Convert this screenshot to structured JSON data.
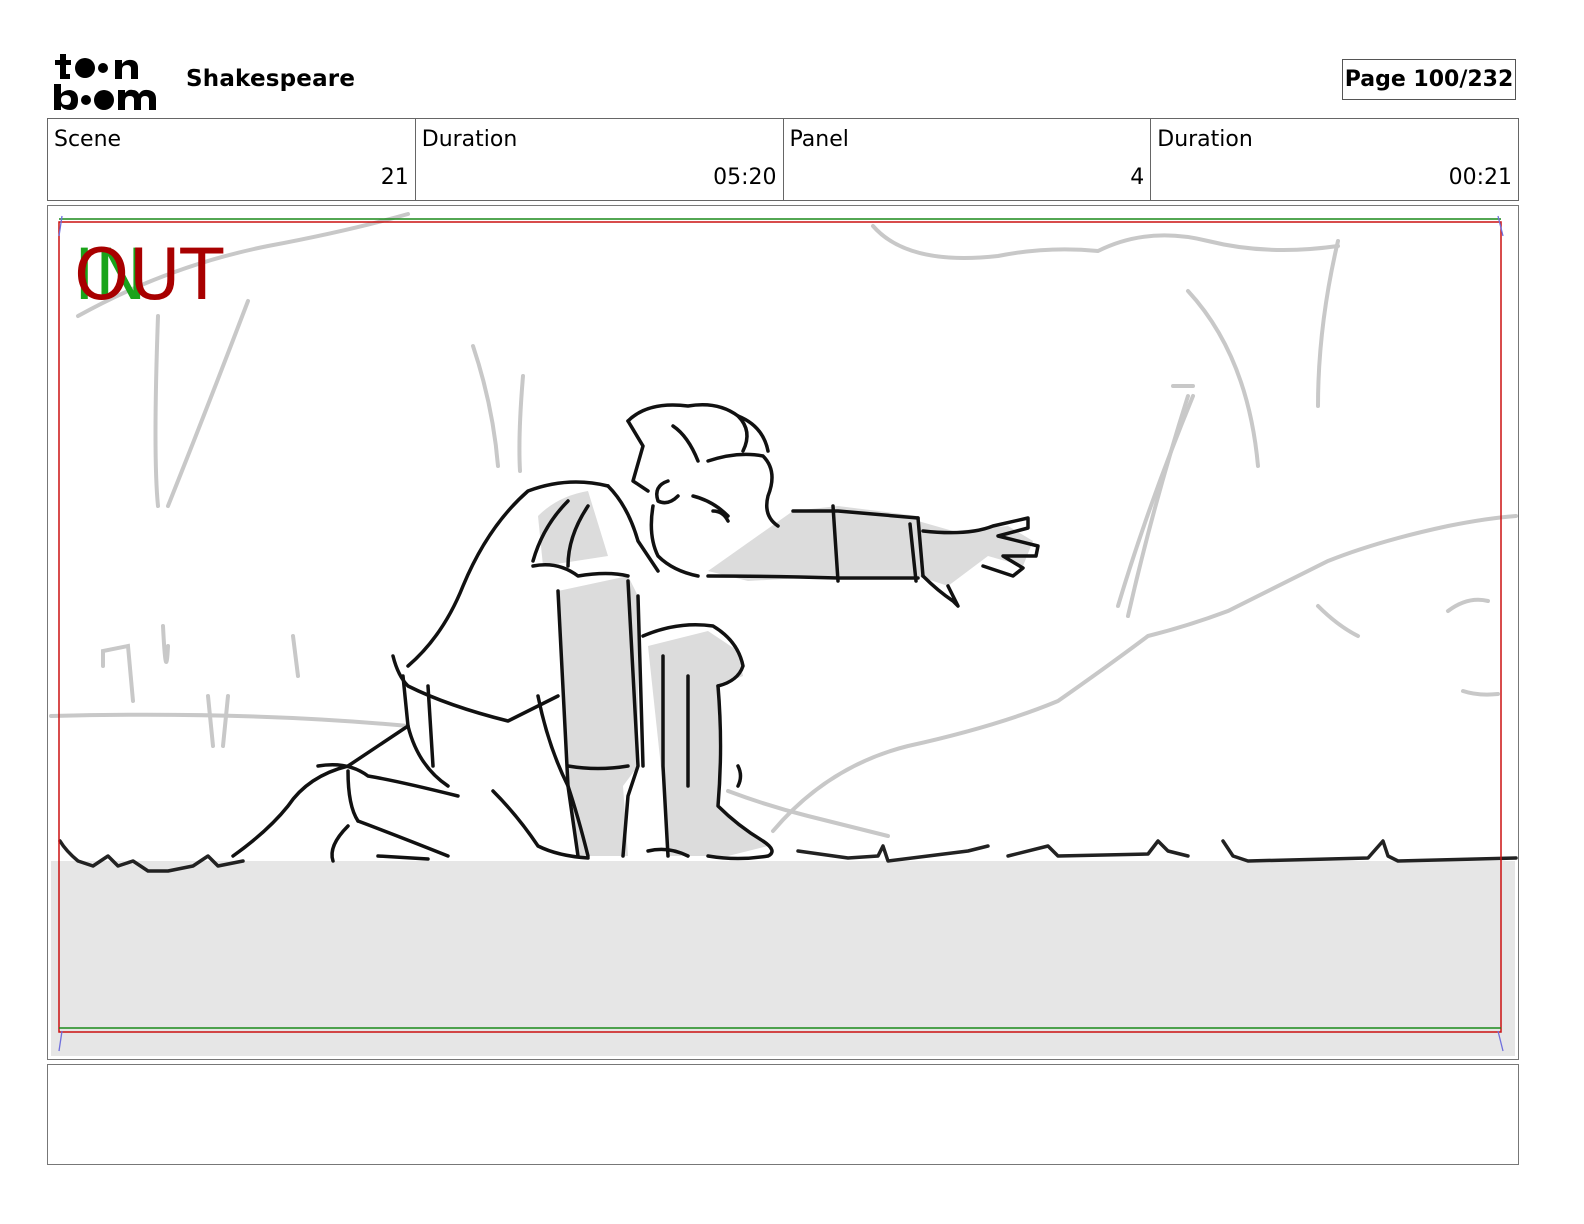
{
  "header": {
    "logo_text": "toon boom",
    "project_title": "Shakespeare",
    "page_label": "Page 100/232"
  },
  "info": {
    "scene_label": "Scene",
    "scene_value": "21",
    "scene_duration_label": "Duration",
    "scene_duration_value": "05:20",
    "panel_label": "Panel",
    "panel_value": "4",
    "panel_duration_label": "Duration",
    "panel_duration_value": "00:21"
  },
  "panel": {
    "in_label": "IN",
    "out_label": "OUT",
    "in_color": "#1aa31a",
    "out_color": "#a80000",
    "ground_color": "#e6e6e6",
    "sketch_color": "#111111",
    "background_line_color": "#c8c8c8",
    "shading_color": "#dcdcdc"
  },
  "notes": {
    "text": ""
  }
}
